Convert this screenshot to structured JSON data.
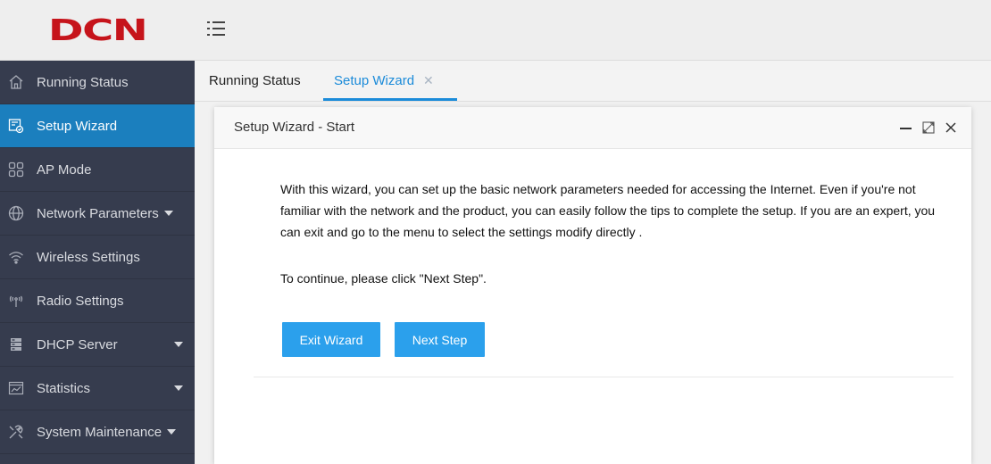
{
  "brand": {
    "logo": "DCN",
    "logo_color": "#c6141b"
  },
  "sidebar": {
    "items": [
      {
        "label": "Running Status",
        "icon": "home-icon"
      },
      {
        "label": "Setup Wizard",
        "icon": "wizard-icon",
        "active": true
      },
      {
        "label": "AP Mode",
        "icon": "grid-icon"
      },
      {
        "label": "Network Parameters",
        "icon": "globe-icon",
        "has_caret": true
      },
      {
        "label": "Wireless Settings",
        "icon": "wifi-icon"
      },
      {
        "label": "Radio Settings",
        "icon": "radio-icon"
      },
      {
        "label": "DHCP Server",
        "icon": "server-icon",
        "has_caret": true
      },
      {
        "label": "Statistics",
        "icon": "chart-icon",
        "has_caret": true
      },
      {
        "label": "System Maintenance",
        "icon": "tools-icon",
        "has_caret": true
      }
    ],
    "active_color": "#1b7fbe",
    "bg_color": "#363c4e"
  },
  "tabs": [
    {
      "label": "Running Status"
    },
    {
      "label": "Setup Wizard",
      "active": true,
      "closable": true
    }
  ],
  "dialog": {
    "title": "Setup Wizard - Start",
    "paragraph1": "With this wizard, you can set up the basic network parameters needed for accessing the Internet. Even if you're not familiar with the network and the product, you can easily follow the tips to complete the setup. If you are an expert, you can exit and go to the menu to select the settings modify directly .",
    "paragraph2": "To continue, please click \"Next Step\".",
    "exit_label": "Exit Wizard",
    "next_label": "Next Step",
    "button_color": "#2ba0ec"
  }
}
